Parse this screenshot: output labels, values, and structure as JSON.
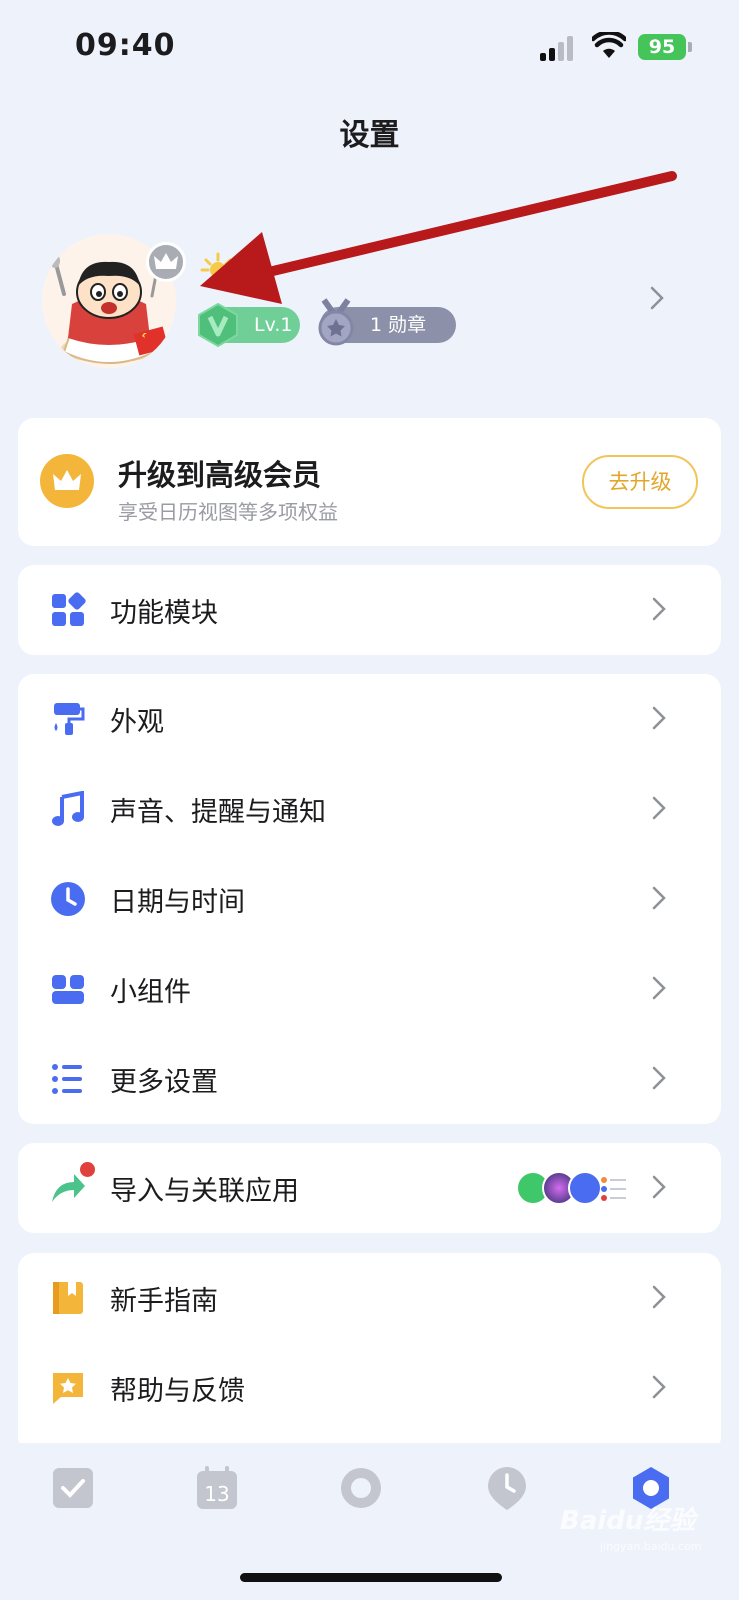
{
  "status_bar": {
    "time": "09:40",
    "battery": "95"
  },
  "header": {
    "title": "设置"
  },
  "profile": {
    "level": "Lv.1",
    "medals": "1 勋章"
  },
  "upgrade": {
    "title": "升级到高级会员",
    "subtitle": "享受日历视图等多项权益",
    "button": "去升级"
  },
  "menu": {
    "module": "功能模块",
    "appearance": "外观",
    "sound": "声音、提醒与通知",
    "datetime": "日期与时间",
    "widget": "小组件",
    "more": "更多设置",
    "import": "导入与关联应用",
    "guide": "新手指南",
    "help": "帮助与反馈"
  },
  "tabbar": {
    "calendar_day": "13"
  },
  "watermark": {
    "brand": "Baidu经验",
    "url": "jingyan.baidu.com"
  },
  "colors": {
    "accent": "#4a6cf0",
    "gold": "#f4b63a",
    "arrow": "#c0191b"
  }
}
